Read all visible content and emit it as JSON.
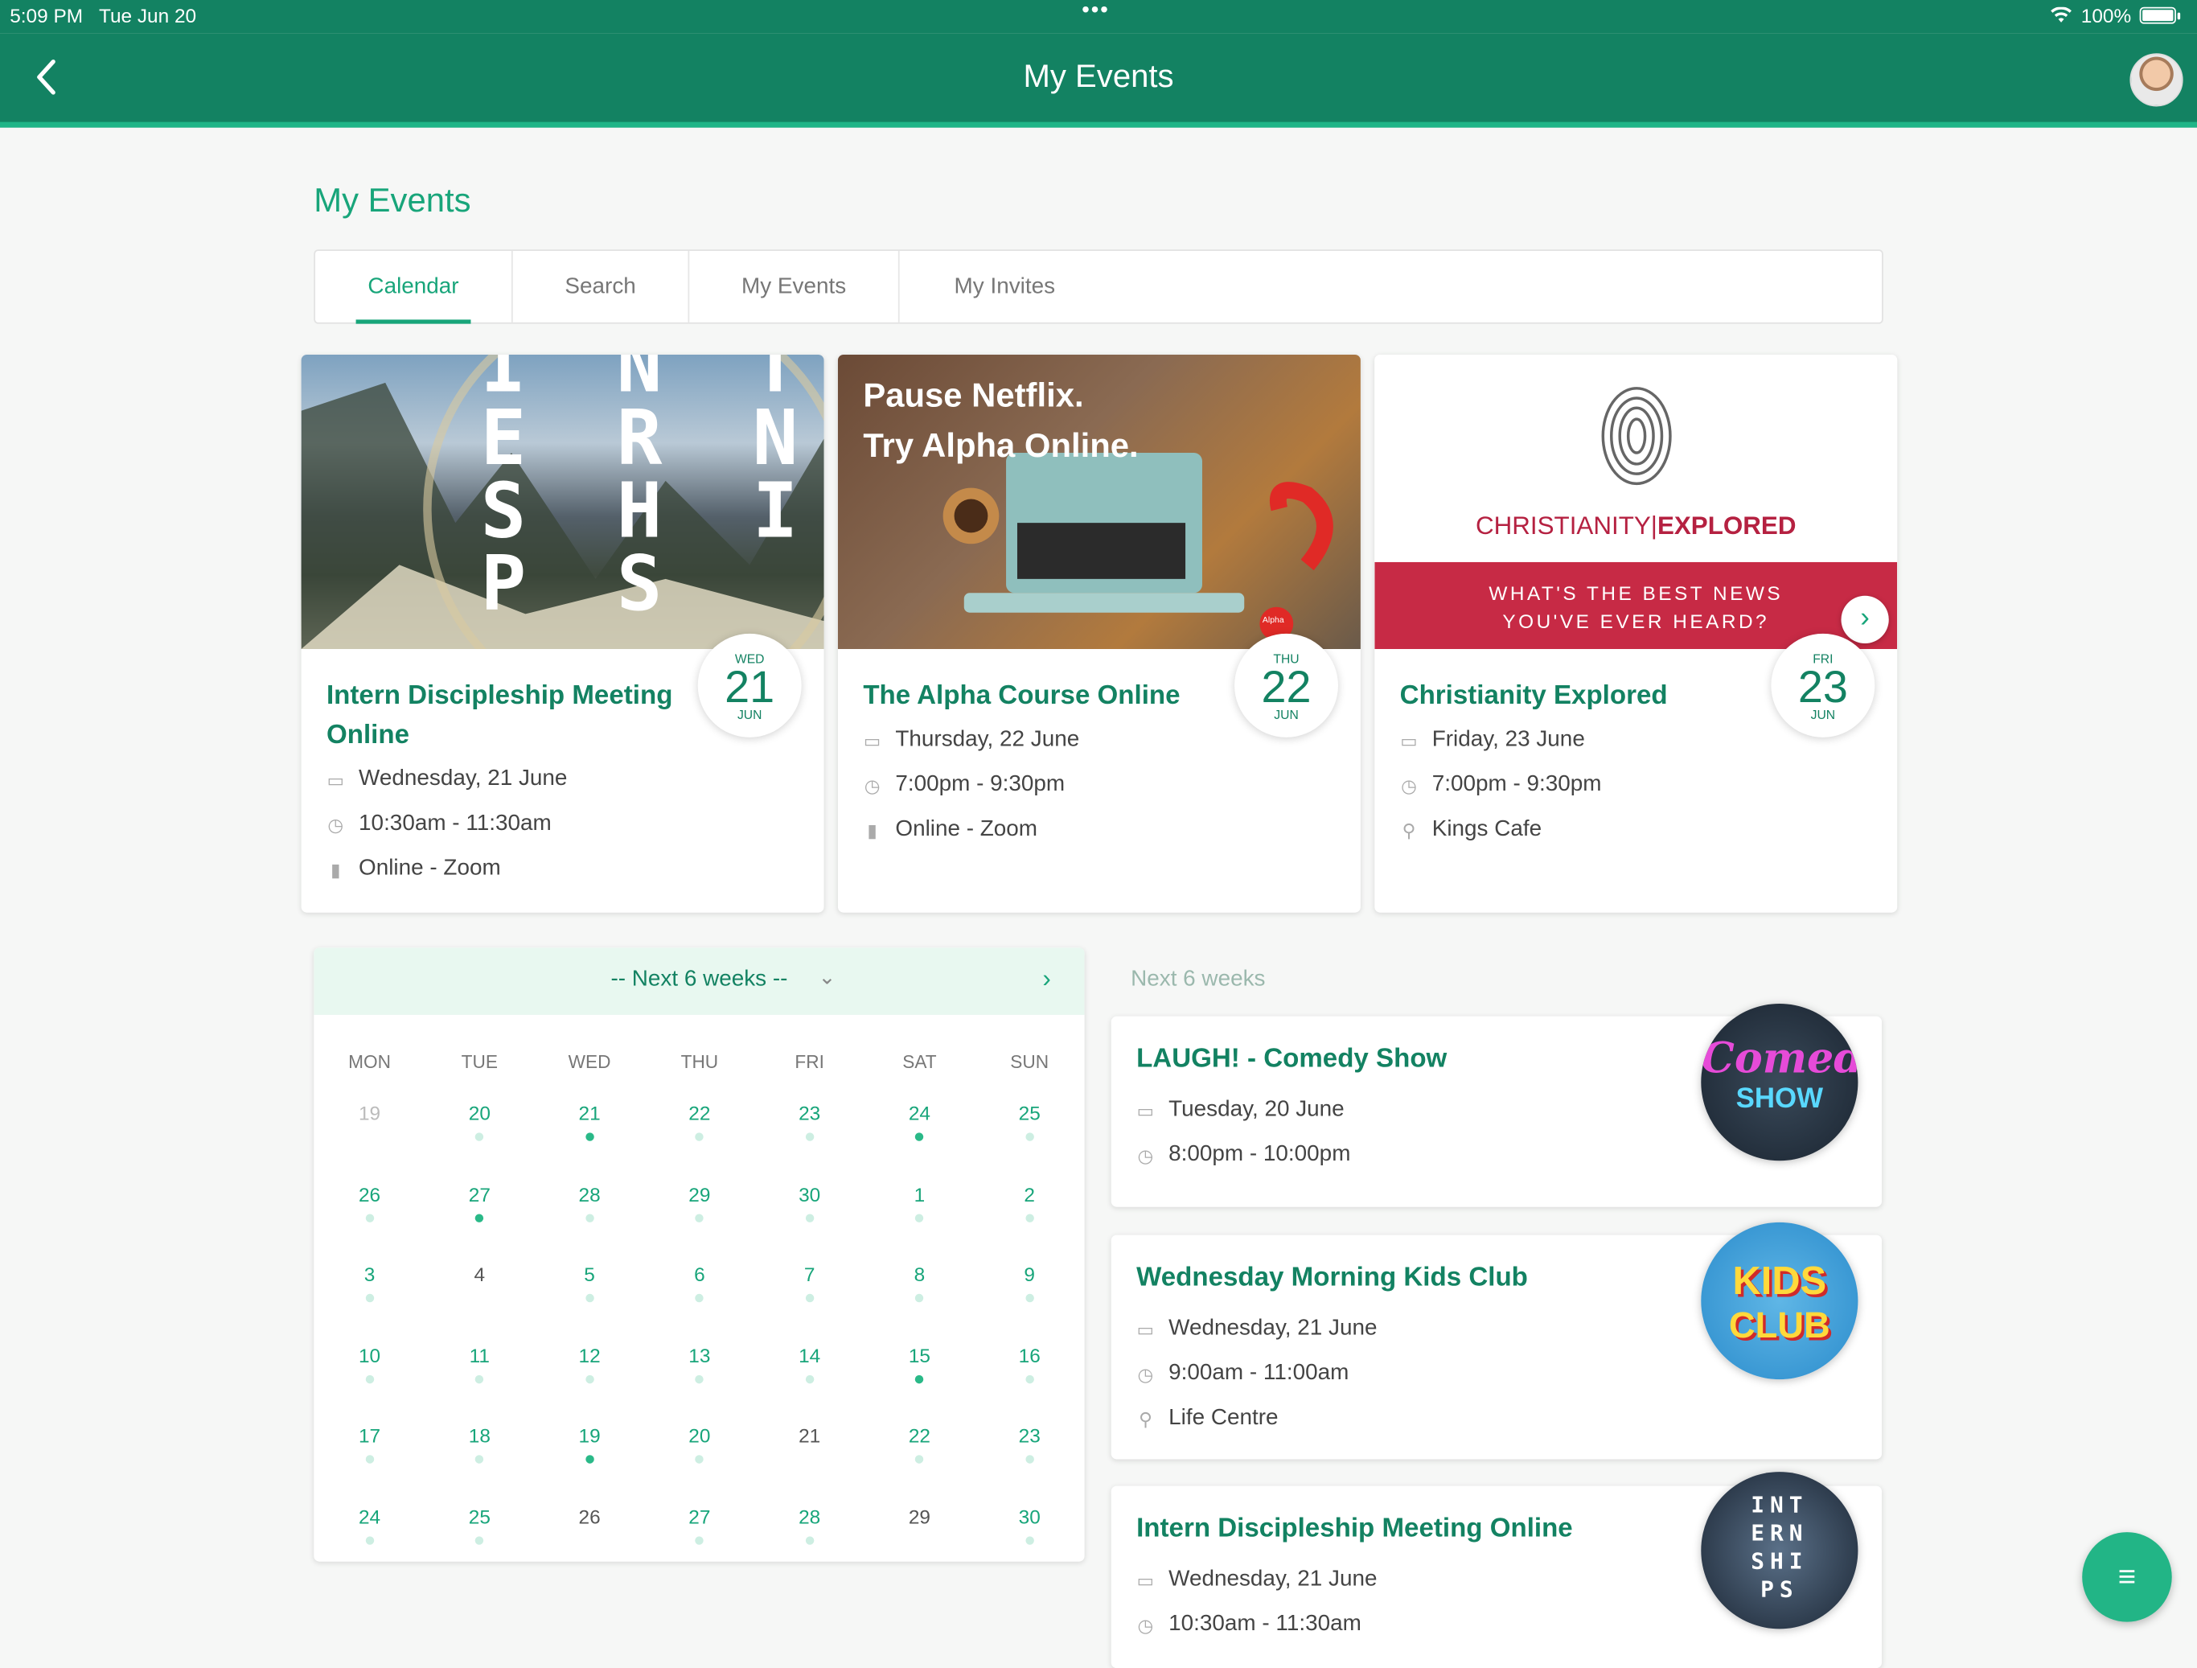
{
  "status": {
    "time": "5:09 PM",
    "date": "Tue Jun 20",
    "dots": "•••",
    "battery": "100%"
  },
  "nav": {
    "title": "My Events"
  },
  "page": {
    "title": "My Events"
  },
  "tabs": [
    "Calendar",
    "Search",
    "My Events",
    "My Invites"
  ],
  "featured": [
    {
      "title": "Intern Discipleship Meeting Online",
      "dow": "WED",
      "day": "21",
      "mon": "JUN",
      "date": "Wednesday, 21 June",
      "time": "10:30am - 11:30am",
      "place": "Online - Zoom",
      "image_text": [
        "I N T",
        "E R N",
        "S H I",
        "P S"
      ]
    },
    {
      "title": "The Alpha Course Online",
      "dow": "THU",
      "day": "22",
      "mon": "JUN",
      "date": "Thursday, 22 June",
      "time": "7:00pm - 9:30pm",
      "place": "Online - Zoom",
      "image_text": [
        "Pause Netflix.",
        "Try Alpha Online."
      ],
      "logo": "Alpha"
    },
    {
      "title": "Christianity Explored",
      "dow": "FRI",
      "day": "23",
      "mon": "JUN",
      "date": "Friday, 23 June",
      "time": "7:00pm - 9:30pm",
      "place": "Kings Cafe",
      "image_text": [
        "CHRISTIANITY",
        "EXPLORED",
        "WHAT'S THE BEST NEWS",
        "YOU'VE EVER HEARD?"
      ]
    }
  ],
  "calendar": {
    "header": "-- Next 6 weeks --",
    "dows": [
      "MON",
      "TUE",
      "WED",
      "THU",
      "FRI",
      "SAT",
      "SUN"
    ],
    "weeks": [
      [
        [
          "19",
          "muted",
          "none"
        ],
        [
          "20",
          "",
          "light"
        ],
        [
          "21",
          "",
          "strong"
        ],
        [
          "22",
          "",
          "light"
        ],
        [
          "23",
          "",
          "light"
        ],
        [
          "24",
          "",
          "strong"
        ],
        [
          "25",
          "",
          "light"
        ]
      ],
      [
        [
          "26",
          "",
          "light"
        ],
        [
          "27",
          "",
          "strong"
        ],
        [
          "28",
          "",
          "light"
        ],
        [
          "29",
          "",
          "light"
        ],
        [
          "30",
          "",
          "light"
        ],
        [
          "1",
          "",
          "light"
        ],
        [
          "2",
          "",
          "light"
        ]
      ],
      [
        [
          "3",
          "",
          "light"
        ],
        [
          "4",
          "plain",
          "none"
        ],
        [
          "5",
          "",
          "light"
        ],
        [
          "6",
          "",
          "light"
        ],
        [
          "7",
          "",
          "light"
        ],
        [
          "8",
          "",
          "light"
        ],
        [
          "9",
          "",
          "light"
        ]
      ],
      [
        [
          "10",
          "",
          "light"
        ],
        [
          "11",
          "",
          "light"
        ],
        [
          "12",
          "",
          "light"
        ],
        [
          "13",
          "",
          "light"
        ],
        [
          "14",
          "",
          "light"
        ],
        [
          "15",
          "",
          "strong"
        ],
        [
          "16",
          "",
          "light"
        ]
      ],
      [
        [
          "17",
          "",
          "light"
        ],
        [
          "18",
          "",
          "light"
        ],
        [
          "19",
          "",
          "strong"
        ],
        [
          "20",
          "",
          "light"
        ],
        [
          "21",
          "plain",
          "none"
        ],
        [
          "22",
          "",
          "light"
        ],
        [
          "23",
          "",
          "light"
        ]
      ],
      [
        [
          "24",
          "",
          "light"
        ],
        [
          "25",
          "",
          "light"
        ],
        [
          "26",
          "plain",
          "none"
        ],
        [
          "27",
          "",
          "light"
        ],
        [
          "28",
          "",
          "light"
        ],
        [
          "29",
          "plain",
          "none"
        ],
        [
          "30",
          "",
          "light"
        ]
      ]
    ]
  },
  "list": {
    "label": "Next 6 weeks",
    "items": [
      {
        "title": "LAUGH! - Comedy Show",
        "date": "Tuesday, 20 June",
        "time": "8:00pm - 10:00pm",
        "thumb": [
          "Comedy",
          "SHOW"
        ]
      },
      {
        "title": "Wednesday Morning Kids Club",
        "date": "Wednesday, 21 June",
        "time": "9:00am - 11:00am",
        "place": "Life Centre",
        "thumb": [
          "KIDS",
          "CLUB"
        ]
      },
      {
        "title": "Intern Discipleship Meeting Online",
        "date": "Wednesday, 21 June",
        "time": "10:30am - 11:30am",
        "thumb": [
          "INT",
          "ERN",
          "SHI",
          "PS"
        ]
      }
    ]
  },
  "colors": {
    "brand": "#138262",
    "accent": "#18a57a",
    "fab": "#22b586"
  }
}
